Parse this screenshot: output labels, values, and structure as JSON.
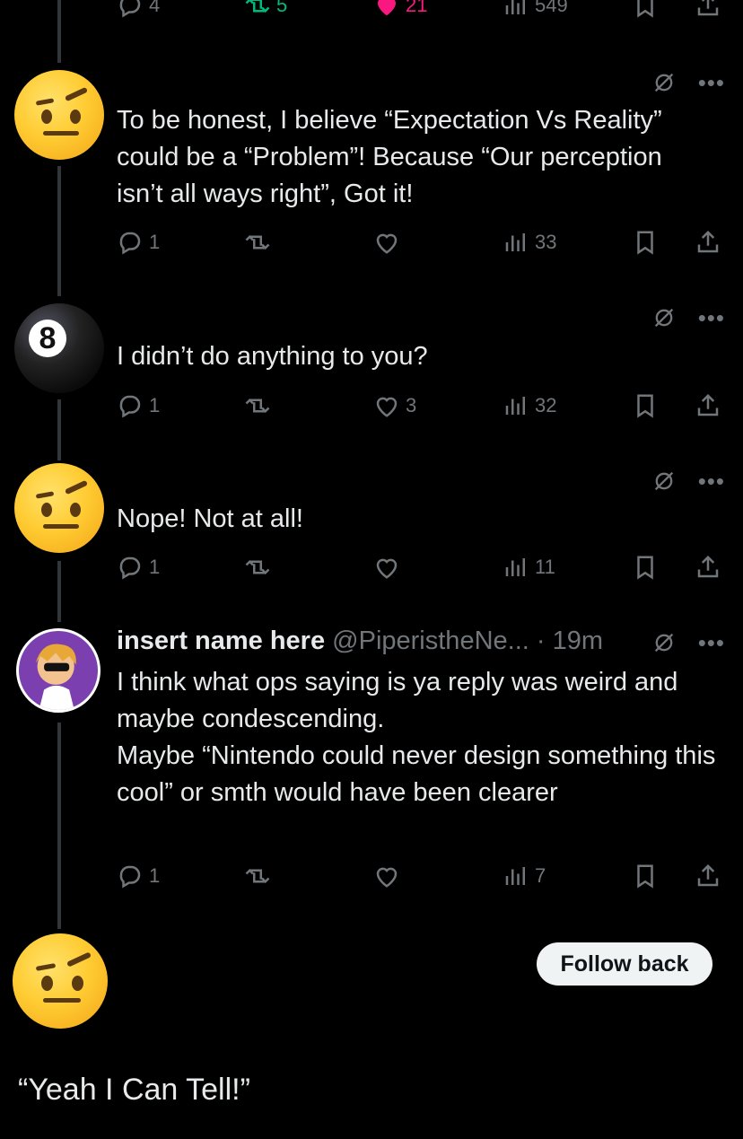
{
  "top_bar": {
    "reply_count": "4",
    "retweet_count": "5",
    "like_count": "21",
    "view_count": "549"
  },
  "tweets": [
    {
      "text": "To be honest, I believe “Expectation Vs Reality” could be a “Problem”! Because “Our perception isn’t all ways right”, Got it!",
      "replies": "1",
      "likes": "",
      "views": "33"
    },
    {
      "text": "I didn’t do anything to you?",
      "replies": "1",
      "likes": "3",
      "views": "32"
    },
    {
      "text": "Nope! Not at all!",
      "replies": "1",
      "likes": "",
      "views": "11"
    },
    {
      "name": "insert name here",
      "handle": "@PiperistheNe...",
      "time": "· 19m",
      "text": "I think what ops saying is ya reply was weird and maybe condescending.\nMaybe “Nintendo could never design something this cool” or smth would have been clearer",
      "replies": "1",
      "likes": "",
      "views": "7"
    }
  ],
  "follow_back_label": "Follow back",
  "caption": "“Yeah I Can Tell!”",
  "colors": {
    "background": "#000000",
    "text": "#e7e9ea",
    "muted": "#71767b",
    "retweet_green": "#00ba7c",
    "like_pink": "#f91880"
  }
}
